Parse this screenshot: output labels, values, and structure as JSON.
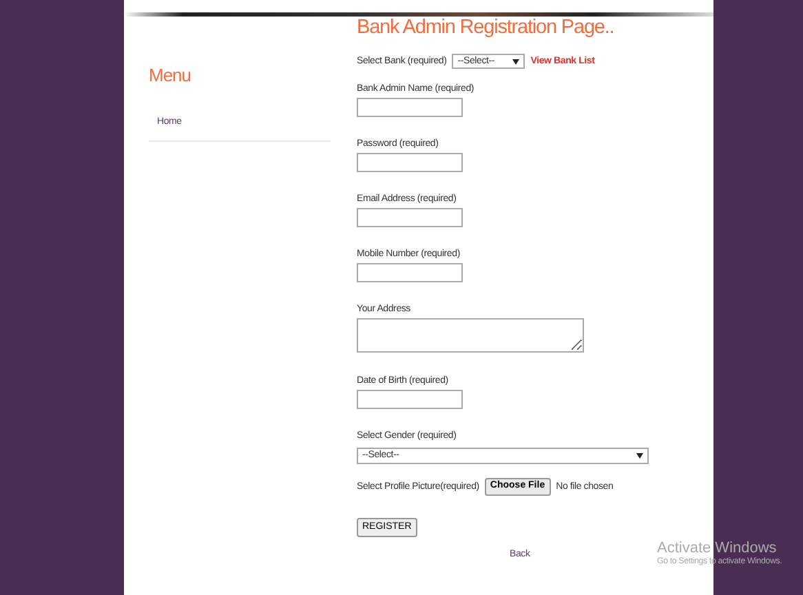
{
  "sidebar": {
    "title": "Menu",
    "items": [
      {
        "label": "Home"
      }
    ]
  },
  "page": {
    "title": "Bank Admin Registration Page.."
  },
  "form": {
    "bank": {
      "label": "Select Bank (required)",
      "value": "--Select--",
      "link": "View Bank List"
    },
    "fields": [
      {
        "kind": "text",
        "label": "Bank Admin Name (required)"
      },
      {
        "kind": "text",
        "label": "Password (required)"
      },
      {
        "kind": "text",
        "label": "Email Address (required)"
      },
      {
        "kind": "text",
        "label": "Mobile Number (required)"
      },
      {
        "kind": "textarea",
        "label": "Your Address"
      },
      {
        "kind": "text",
        "label": "Date of Birth (required)"
      },
      {
        "kind": "select",
        "label": "Select Gender (required)",
        "value": "--Select--"
      }
    ],
    "file": {
      "label": "Select Profile Picture(required)",
      "button": "Choose File",
      "status": "No file chosen"
    },
    "submit": "REGISTER",
    "back": "Back"
  },
  "overlay": {
    "title": "Activate Windows",
    "subtitle": "Go to Settings to activate Windows."
  }
}
